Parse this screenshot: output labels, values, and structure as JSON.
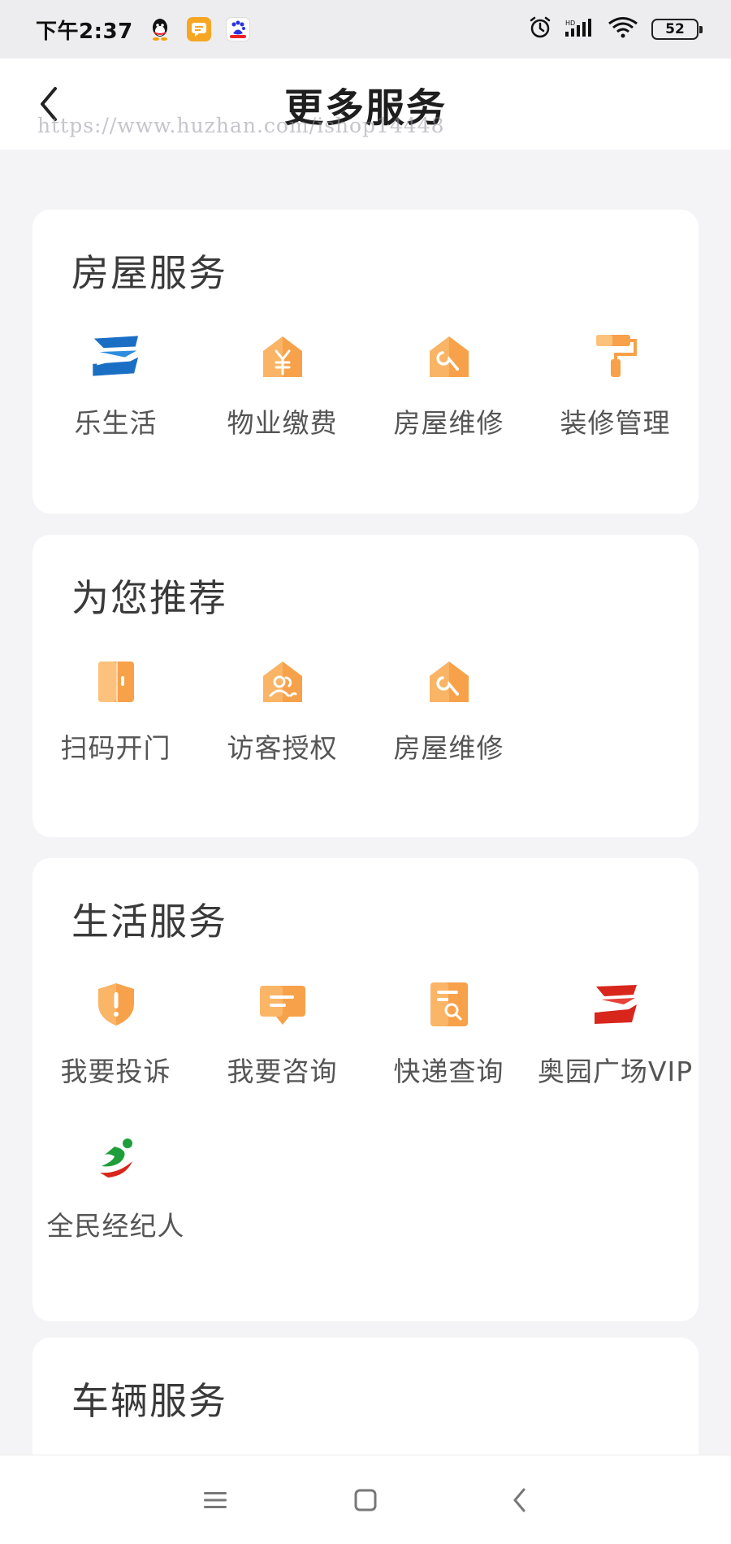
{
  "status_bar": {
    "time": "下午2:37",
    "battery": "52",
    "icons": [
      "qq-icon",
      "message-app-icon",
      "baidu-icon",
      "alarm-icon",
      "signal-icon",
      "wifi-icon",
      "battery-icon"
    ]
  },
  "header": {
    "title": "更多服务",
    "watermark": "https://www.huzhan.com/ishop14448"
  },
  "sections": [
    {
      "title": "房屋服务",
      "items": [
        {
          "label": "乐生活",
          "icon": "le-life-logo-icon"
        },
        {
          "label": "物业缴费",
          "icon": "property-fee-icon"
        },
        {
          "label": "房屋维修",
          "icon": "house-repair-icon"
        },
        {
          "label": "装修管理",
          "icon": "paint-roller-icon"
        }
      ]
    },
    {
      "title": "为您推荐",
      "items": [
        {
          "label": "扫码开门",
          "icon": "door-icon"
        },
        {
          "label": "访客授权",
          "icon": "visitor-icon"
        },
        {
          "label": "房屋维修",
          "icon": "house-repair-icon"
        }
      ]
    },
    {
      "title": "生活服务",
      "items": [
        {
          "label": "我要投诉",
          "icon": "complaint-shield-icon"
        },
        {
          "label": "我要咨询",
          "icon": "consult-chat-icon"
        },
        {
          "label": "快递查询",
          "icon": "express-search-icon"
        },
        {
          "label": "奥园广场VIP",
          "icon": "aoyuan-plaza-logo-icon"
        },
        {
          "label": "全民经纪人",
          "icon": "broker-runner-icon"
        }
      ]
    },
    {
      "title": "车辆服务",
      "items": []
    }
  ],
  "nav_bar": {
    "icons": [
      "menu-icon",
      "home-square-icon",
      "back-triangle-icon"
    ]
  },
  "colors": {
    "accent_orange": "#f7a24a",
    "accent_orange_light": "#fcc27b",
    "background": "#f4f4f6",
    "card": "#ffffff"
  }
}
